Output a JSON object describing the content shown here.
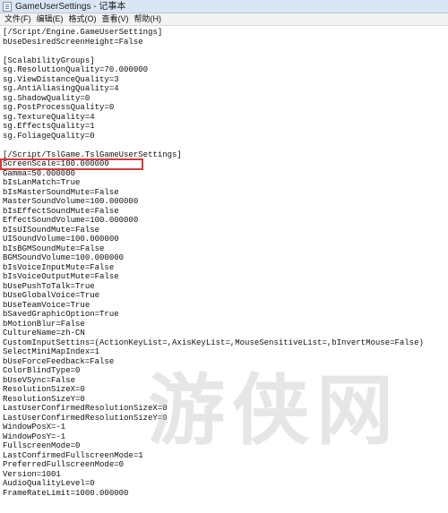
{
  "window": {
    "title": "GameUserSettings - 记事本"
  },
  "menu": [
    "文件(F)",
    "编辑(E)",
    "格式(O)",
    "查看(V)",
    "帮助(H)"
  ],
  "lines": [
    "[/Script/Engine.GameUserSettings]",
    "bUseDesiredScreenHeight=False",
    "",
    "[ScalabilityGroups]",
    "sg.ResolutionQuality=70.000000",
    "sg.ViewDistanceQuality=3",
    "sg.AntiAliasingQuality=4",
    "sg.ShadowQuality=0",
    "sg.PostProcessQuality=0",
    "sg.TextureQuality=4",
    "sg.EffectsQuality=1",
    "sg.FoliageQuality=0",
    "",
    "[/Script/TslGame.TslGameUserSettings]",
    "ScreenScale=100.000000",
    "Gamma=50.000000",
    "bIsLanMatch=True",
    "bIsMasterSoundMute=False",
    "MasterSoundVolume=100.000000",
    "bIsEffectSoundMute=False",
    "EffectSoundVolume=100.000000",
    "bIsUISoundMute=False",
    "UISoundVolume=100.000000",
    "bIsBGMSoundMute=False",
    "BGMSoundVolume=100.000000",
    "bIsVoiceInputMute=False",
    "bIsVoiceOutputMute=False",
    "bUsePushToTalk=True",
    "bUseGlobalVoice=True",
    "bUseTeamVoice=True",
    "bSavedGraphicOption=True",
    "bMotionBlur=False",
    "CultureName=zh-CN",
    "CustomInputSettins=(ActionKeyList=,AxisKeyList=,MouseSensitiveList=,bInvertMouse=False)",
    "SelectMiniMapIndex=1",
    "bUseForceFeedback=False",
    "ColorBlindType=0",
    "bUseVSync=False",
    "ResolutionSizeX=0",
    "ResolutionSizeY=0",
    "LastUserConfirmedResolutionSizeX=0",
    "LastUserConfirmedResolutionSizeY=0",
    "WindowPosX=-1",
    "WindowPosY=-1",
    "FullscreenMode=0",
    "LastConfirmedFullscreenMode=1",
    "PreferredFullscreenMode=0",
    "Version=1001",
    "AudioQualityLevel=0",
    "FrameRateLimit=1000.000000"
  ],
  "highlight_line_index": 14,
  "watermark_text": "游侠网",
  "colors": {
    "highlight": "#d33a3a"
  }
}
